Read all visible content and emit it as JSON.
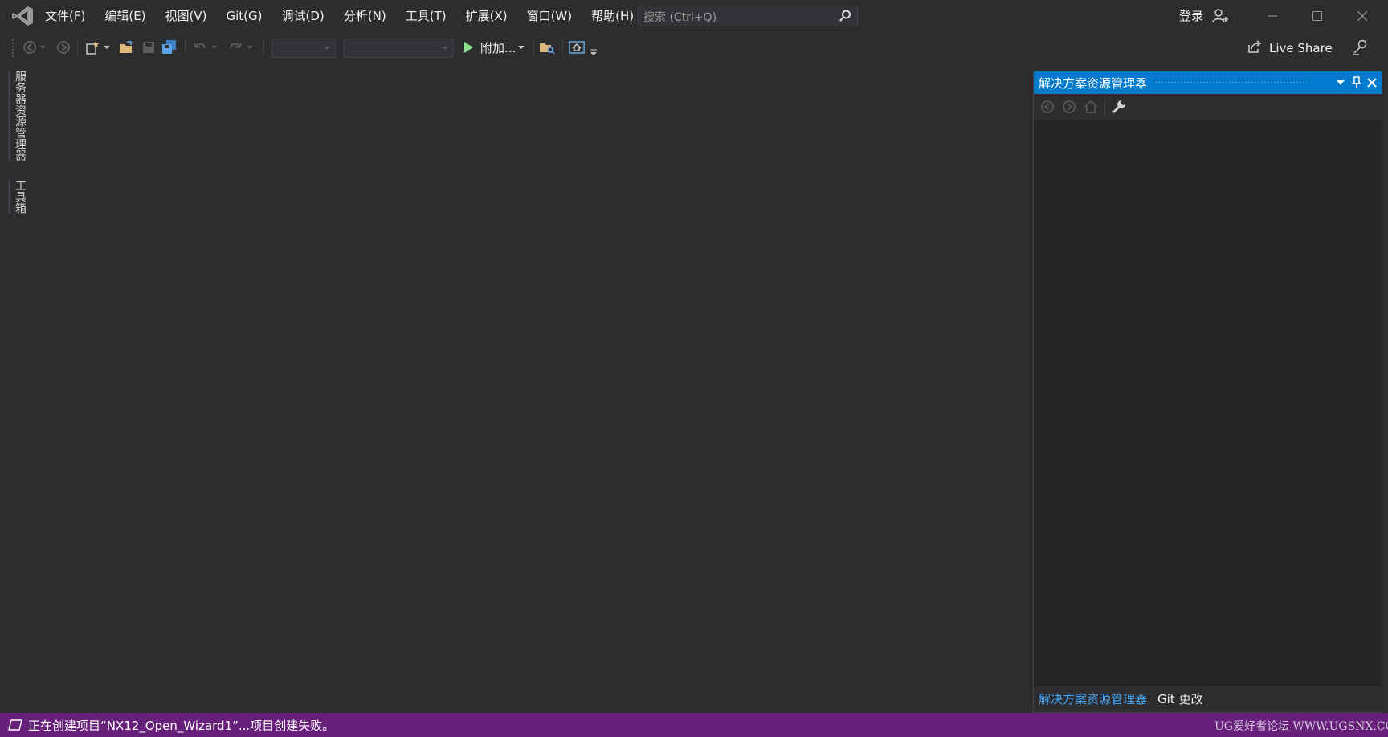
{
  "menu": {
    "items": [
      "文件(F)",
      "编辑(E)",
      "视图(V)",
      "Git(G)",
      "调试(D)",
      "分析(N)",
      "工具(T)",
      "扩展(X)",
      "窗口(W)",
      "帮助(H)"
    ]
  },
  "search": {
    "placeholder": "搜索 (Ctrl+Q)"
  },
  "account": {
    "sign_in_label": "登录"
  },
  "toolbar": {
    "attach_label": "附加...",
    "live_share_label": "Live Share"
  },
  "left_rail": {
    "server_explorer": "服务器资源管理器",
    "toolbox": "工具箱"
  },
  "solution_explorer": {
    "title": "解决方案资源管理器",
    "tabs": [
      "解决方案资源管理器",
      "Git 更改"
    ]
  },
  "status": {
    "message": "正在创建项目“NX12_Open_Wizard1”...项目创建失败。",
    "watermark": "UG爱好者论坛 WWW.UGSNX.COM"
  },
  "colors": {
    "accent": "#007acc",
    "status_bar": "#68217a",
    "background": "#2d2d30",
    "play_green": "#8ae28a"
  },
  "icons": [
    "vs-logo-icon",
    "search-icon",
    "account-icon",
    "minimize-icon",
    "maximize-icon",
    "close-icon",
    "back-icon",
    "forward-icon",
    "new-project-icon",
    "open-folder-icon",
    "save-icon",
    "save-all-icon",
    "undo-icon",
    "redo-icon",
    "play-icon",
    "find-in-files-icon",
    "home-icon",
    "live-share-icon",
    "feedback-icon",
    "pin-icon",
    "settings-wrench-icon",
    "status-info-icon"
  ]
}
